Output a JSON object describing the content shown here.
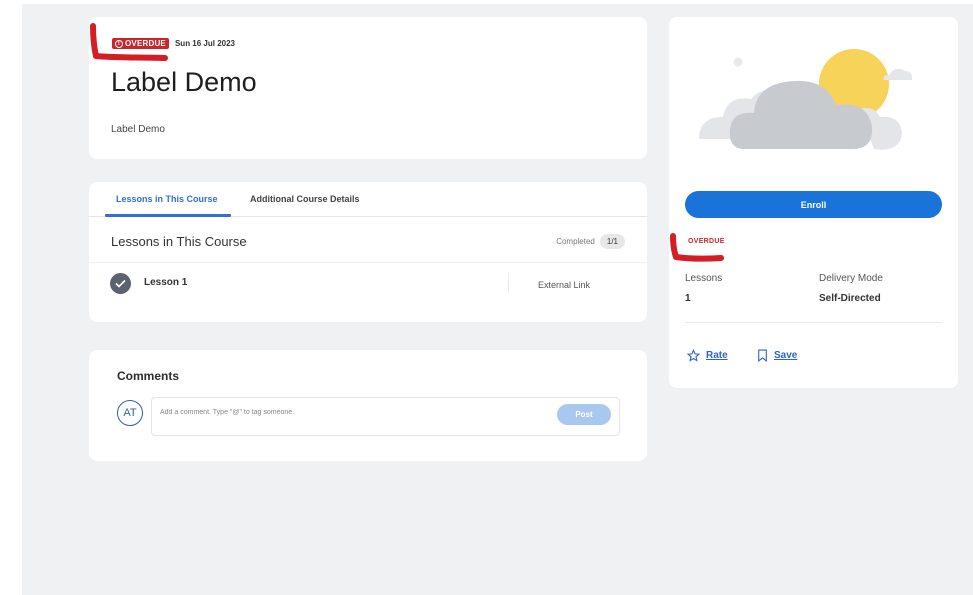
{
  "header": {
    "overdue_badge": "OVERDUE",
    "date": "Sun 16 Jul 2023",
    "title": "Label Demo",
    "description": "Label Demo"
  },
  "lessons_card": {
    "tabs": [
      {
        "label": "Lessons in This Course",
        "active": true
      },
      {
        "label": "Additional Course Details",
        "active": false
      }
    ],
    "section_title": "Lessons in This Course",
    "completed_label": "Completed",
    "completed_count": "1/1",
    "lessons": [
      {
        "name": "Lesson 1",
        "type": "External Link",
        "completed": true
      }
    ]
  },
  "comments": {
    "title": "Comments",
    "avatar_initials": "AT",
    "placeholder": "Add a comment. Type \"@\" to tag someone.",
    "post_label": "Post"
  },
  "side_panel": {
    "enroll_label": "Enroll",
    "status": "OVERDUE",
    "lessons_label": "Lessons",
    "lessons_value": "1",
    "delivery_label": "Delivery Mode",
    "delivery_value": "Self-Directed",
    "rate_label": "Rate",
    "save_label": "Save"
  },
  "colors": {
    "accent": "#1a73d9",
    "overdue": "#c9262b",
    "background": "#f0f1f3",
    "annotation": "#d41e24"
  },
  "icons": [
    "warning-icon",
    "check-icon",
    "star-icon",
    "bookmark-icon",
    "cloud-sun-illustration"
  ]
}
